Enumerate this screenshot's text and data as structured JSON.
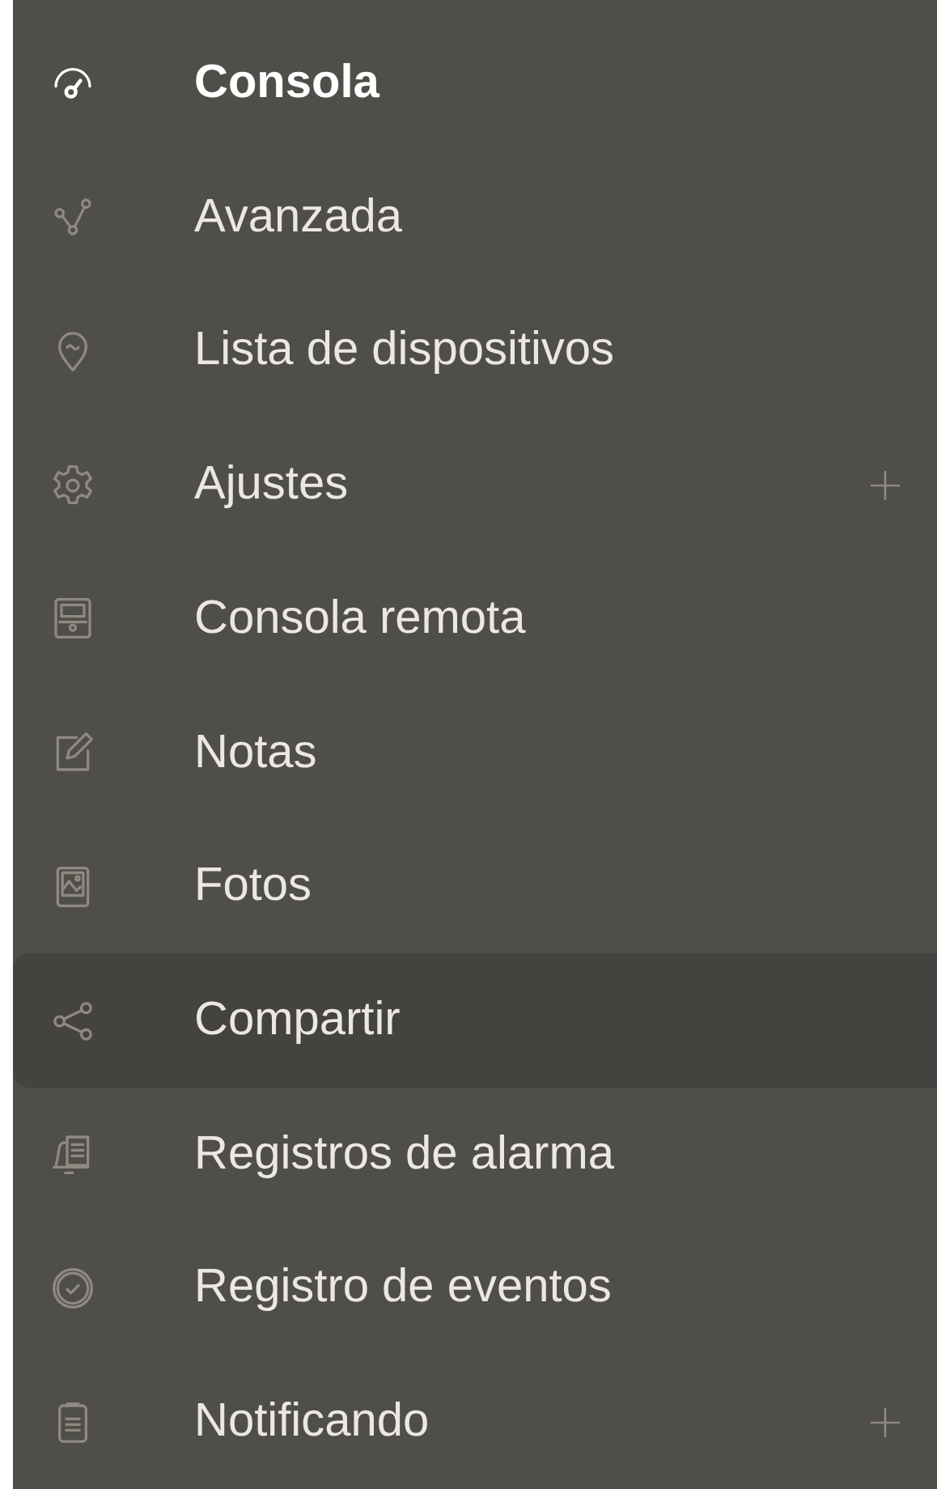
{
  "sidebar": {
    "items": [
      {
        "label": "Consola",
        "current": true,
        "hovered": false,
        "expandable": false
      },
      {
        "label": "Avanzada",
        "current": false,
        "hovered": false,
        "expandable": false
      },
      {
        "label": "Lista de dispositivos",
        "current": false,
        "hovered": false,
        "expandable": false
      },
      {
        "label": "Ajustes",
        "current": false,
        "hovered": false,
        "expandable": true
      },
      {
        "label": "Consola remota",
        "current": false,
        "hovered": false,
        "expandable": false
      },
      {
        "label": "Notas",
        "current": false,
        "hovered": false,
        "expandable": false
      },
      {
        "label": "Fotos",
        "current": false,
        "hovered": false,
        "expandable": false
      },
      {
        "label": "Compartir",
        "current": false,
        "hovered": true,
        "expandable": false
      },
      {
        "label": "Registros de alarma",
        "current": false,
        "hovered": false,
        "expandable": false
      },
      {
        "label": "Registro de eventos",
        "current": false,
        "hovered": false,
        "expandable": false
      },
      {
        "label": "Notificando",
        "current": false,
        "hovered": false,
        "expandable": true
      }
    ]
  }
}
